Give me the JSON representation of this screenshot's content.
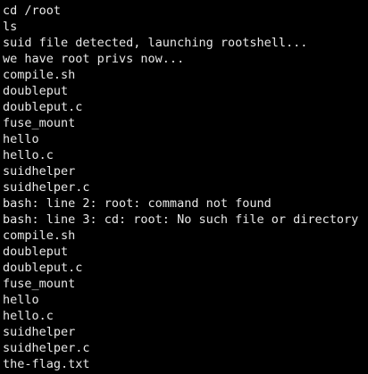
{
  "terminal": {
    "colors": {
      "background": "#000000",
      "foreground": "#e8e8e8"
    },
    "lines": [
      "cd /root",
      "ls",
      "suid file detected, launching rootshell...",
      "we have root privs now...",
      "compile.sh",
      "doubleput",
      "doubleput.c",
      "fuse_mount",
      "hello",
      "hello.c",
      "suidhelper",
      "suidhelper.c",
      "bash: line 2: root: command not found",
      "bash: line 3: cd: root: No such file or directory",
      "compile.sh",
      "doubleput",
      "doubleput.c",
      "fuse_mount",
      "hello",
      "hello.c",
      "suidhelper",
      "suidhelper.c",
      "the-flag.txt"
    ]
  }
}
